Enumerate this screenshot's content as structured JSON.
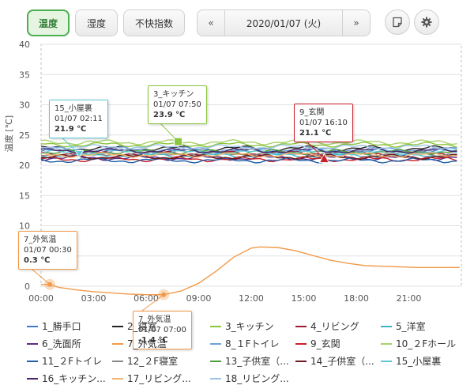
{
  "toolbar": {
    "tabs": [
      {
        "label": "温度",
        "active": true
      },
      {
        "label": "湿度",
        "active": false
      },
      {
        "label": "不快指数",
        "active": false
      }
    ],
    "prev_label": "«",
    "date": "2020/01/07 (火)",
    "next_label": "»",
    "note_icon": "note-icon",
    "settings_icon": "gear-icon"
  },
  "chart_data": {
    "type": "line",
    "ylabel": "温度 [℃]",
    "ylim": [
      0,
      40
    ],
    "yticks": [
      0,
      5,
      10,
      15,
      20,
      25,
      30,
      35,
      40
    ],
    "xlim": [
      0,
      24
    ],
    "xticks": [
      "00:00",
      "03:00",
      "06:00",
      "09:00",
      "12:00",
      "15:00",
      "18:00",
      "21:00"
    ],
    "grid": true,
    "series": [
      {
        "name": "1_勝手口",
        "color": "#3b7dc4",
        "base": 22.3
      },
      {
        "name": "2_寝室",
        "color": "#222222",
        "base": 22.8
      },
      {
        "name": "3_キッチン",
        "color": "#8cc63f",
        "base": 23.4
      },
      {
        "name": "4_リビング",
        "color": "#9b1b30",
        "base": 22.0
      },
      {
        "name": "5_洋室",
        "color": "#3fb6c8",
        "base": 21.6
      },
      {
        "name": "6_洗面所",
        "color": "#5b2c83",
        "base": 21.2
      },
      {
        "name": "7_外気温",
        "color": "#f19a4a",
        "points": [
          [
            0,
            0.3
          ],
          [
            0.5,
            0.3
          ],
          [
            1,
            -0.2
          ],
          [
            2,
            -0.6
          ],
          [
            3,
            -0.9
          ],
          [
            4,
            -1.1
          ],
          [
            5,
            -1.3
          ],
          [
            6,
            -1.4
          ],
          [
            7,
            -1.4
          ],
          [
            8,
            -0.8
          ],
          [
            9,
            0.5
          ],
          [
            10,
            2.5
          ],
          [
            11,
            4.8
          ],
          [
            12,
            6.3
          ],
          [
            12.5,
            6.5
          ],
          [
            13.5,
            6.4
          ],
          [
            14.5,
            5.9
          ],
          [
            15.5,
            5.1
          ],
          [
            16.5,
            4.3
          ],
          [
            17.5,
            3.8
          ],
          [
            18.5,
            3.4
          ],
          [
            19.5,
            3.3
          ],
          [
            20.5,
            3.2
          ],
          [
            21.5,
            3.1
          ],
          [
            22.5,
            3.1
          ],
          [
            23.9,
            3.1
          ]
        ]
      },
      {
        "name": "8_１Fトイレ",
        "color": "#6fa3d9",
        "base": 22.6
      },
      {
        "name": "9_玄関",
        "color": "#c8202a",
        "base": 21.0
      },
      {
        "name": "10_２Fホール",
        "color": "#a9d26a",
        "base": 23.8
      },
      {
        "name": "11_２Fトイレ",
        "color": "#1d5fa8",
        "base": 20.8
      },
      {
        "name": "12_２F寝室",
        "color": "#888888",
        "base": 21.9
      },
      {
        "name": "13_子供室（...",
        "color": "#4f9e3f",
        "base": 22.2
      },
      {
        "name": "14_子供室（...",
        "color": "#6b1820",
        "base": 21.4
      },
      {
        "name": "15_小屋裏",
        "color": "#5fc8d6",
        "base": 22.1
      },
      {
        "name": "16_キッチン...",
        "color": "#4a2266",
        "base": 22.4
      },
      {
        "name": "17_リビング...",
        "color": "#f5b26b",
        "base": 21.7
      },
      {
        "name": "18_リビング...",
        "color": "#9cc2e6",
        "base": 23.0
      }
    ],
    "tooltips": [
      {
        "series": "15_小屋裏",
        "time": "01/07 02:11",
        "value": "21.9 ℃",
        "border": "#5fc8d6",
        "at": [
          2.18,
          21.9
        ],
        "marker": "triangle-down"
      },
      {
        "series": "3_キッチン",
        "time": "01/07 07:50",
        "value": "23.9 ℃",
        "border": "#8cc63f",
        "at": [
          7.83,
          23.9
        ],
        "marker": "square"
      },
      {
        "series": "9_玄関",
        "time": "01/07 16:10",
        "value": "21.1 ℃",
        "border": "#c8202a",
        "at": [
          16.17,
          21.1
        ],
        "marker": "triangle-up"
      },
      {
        "series": "7_外気温",
        "time": "01/07 00:30",
        "value": "0.3 ℃",
        "border": "#f19a4a",
        "at": [
          0.5,
          0.3
        ],
        "marker": "circle"
      },
      {
        "series": "7_外気温",
        "time": "01/07 07:00",
        "value": "-1.4 ℃",
        "border": "#f19a4a",
        "at": [
          7.0,
          -1.4
        ],
        "marker": "circle"
      }
    ]
  }
}
